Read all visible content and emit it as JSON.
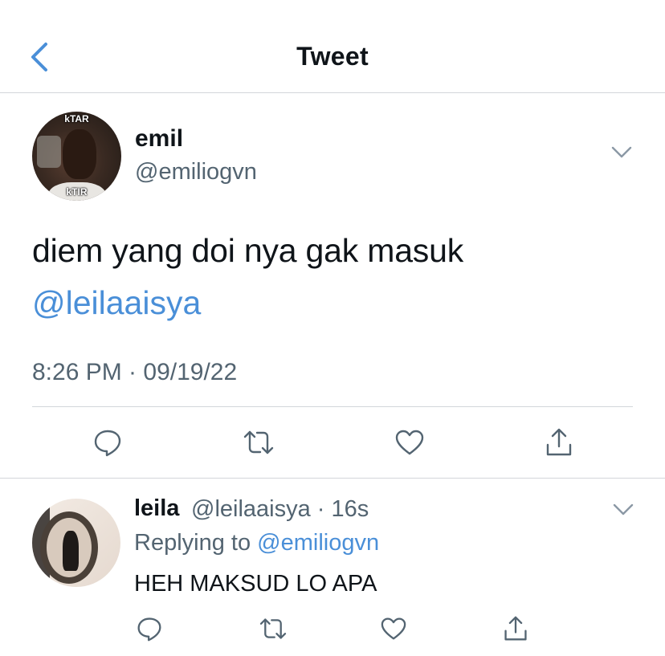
{
  "header": {
    "title": "Tweet",
    "back_icon": "chevron-left-icon"
  },
  "colors": {
    "link": "#4a8fd8",
    "secondary_text": "#536471",
    "icon": "#536471",
    "divider": "#d3d6da"
  },
  "main_tweet": {
    "display_name": "emil",
    "handle": "@emiliogvn",
    "avatar_text_top": "kTAR",
    "avatar_text_bottom": "kTIR",
    "text": "diem yang doi nya gak masuk",
    "mention": "@leilaaisya",
    "timestamp": "8:26 PM · 09/19/22",
    "actions": [
      "reply-icon",
      "retweet-icon",
      "like-icon",
      "share-icon"
    ]
  },
  "reply": {
    "display_name": "leila",
    "handle_time": "@leilaaisya · 16s",
    "replying_prefix": "Replying to ",
    "replying_to": "@emiliogvn",
    "text": "HEH MAKSUD LO APA",
    "actions": [
      "reply-icon",
      "retweet-icon",
      "like-icon",
      "share-icon"
    ]
  }
}
